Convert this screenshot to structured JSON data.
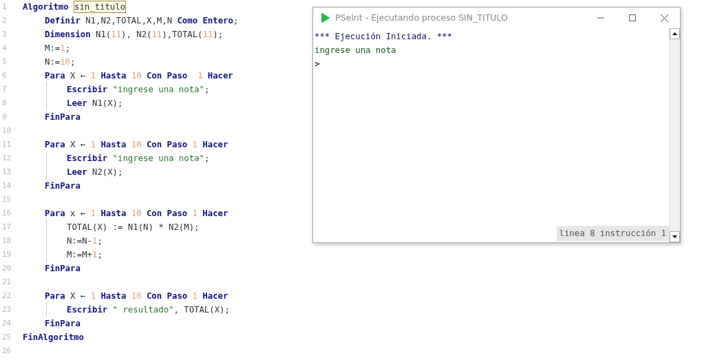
{
  "editor": {
    "lines": [
      {
        "number": "1",
        "tokens": [
          {
            "kind": "keyword",
            "text": "Algoritmo",
            "space_after": true
          },
          {
            "kind": "name",
            "text": "sin_titulo"
          }
        ],
        "children": [
          {
            "number": "2",
            "tokens": [
              {
                "kind": "keyword",
                "text": "Definir",
                "space_after": true
              },
              {
                "kind": "plain",
                "text": "N1,N2,TOTAL,X,M,N",
                "space_after": true
              },
              {
                "kind": "keyword",
                "text": "Como Entero"
              },
              {
                "kind": "plain",
                "text": ";"
              }
            ]
          },
          {
            "number": "3",
            "tokens": [
              {
                "kind": "keyword",
                "text": "Dimension",
                "space_after": true
              },
              {
                "kind": "plain",
                "text": "N1("
              },
              {
                "kind": "number",
                "text": "11"
              },
              {
                "kind": "plain",
                "text": "), N2("
              },
              {
                "kind": "number",
                "text": "11"
              },
              {
                "kind": "plain",
                "text": "),TOTAL("
              },
              {
                "kind": "number",
                "text": "11"
              },
              {
                "kind": "plain",
                "text": ");"
              }
            ]
          },
          {
            "number": "4",
            "tokens": [
              {
                "kind": "plain",
                "text": "M:="
              },
              {
                "kind": "number",
                "text": "1"
              },
              {
                "kind": "plain",
                "text": ";"
              }
            ]
          },
          {
            "number": "5",
            "tokens": [
              {
                "kind": "plain",
                "text": "N:="
              },
              {
                "kind": "number",
                "text": "10"
              },
              {
                "kind": "plain",
                "text": ";"
              }
            ]
          },
          {
            "number": "6",
            "tokens": [
              {
                "kind": "keyword",
                "text": "Para",
                "space_after": true
              },
              {
                "kind": "plain",
                "text": "X ←",
                "space_after": true
              },
              {
                "kind": "number",
                "text": "1",
                "space_after": true
              },
              {
                "kind": "keyword",
                "text": "Hasta",
                "space_after": true
              },
              {
                "kind": "number",
                "text": "10",
                "space_after": true
              },
              {
                "kind": "keyword",
                "text": "Con Paso",
                "space_after": true
              },
              {
                "kind": "number",
                "text": "1",
                "space_before": true,
                "space_after": true
              },
              {
                "kind": "keyword",
                "text": "Hacer"
              }
            ],
            "children": [
              {
                "number": "7",
                "tokens": [
                  {
                    "kind": "keyword",
                    "text": "Escribir",
                    "space_after": true
                  },
                  {
                    "kind": "string",
                    "text": "\"ingrese una nota\""
                  },
                  {
                    "kind": "plain",
                    "text": ";"
                  }
                ]
              },
              {
                "number": "8",
                "tokens": [
                  {
                    "kind": "keyword",
                    "text": "Leer",
                    "space_after": true
                  },
                  {
                    "kind": "plain",
                    "text": "N1(X);"
                  }
                ]
              }
            ]
          },
          {
            "number": "9",
            "tokens": [
              {
                "kind": "keyword",
                "text": "FinPara"
              }
            ]
          },
          {
            "number": "10"
          },
          {
            "number": "11",
            "tokens": [
              {
                "kind": "keyword",
                "text": "Para",
                "space_after": true
              },
              {
                "kind": "plain",
                "text": "X ←",
                "space_after": true
              },
              {
                "kind": "number",
                "text": "1",
                "space_after": true
              },
              {
                "kind": "keyword",
                "text": "Hasta",
                "space_after": true
              },
              {
                "kind": "number",
                "text": "10",
                "space_after": true
              },
              {
                "kind": "keyword",
                "text": "Con Paso",
                "space_after": true
              },
              {
                "kind": "number",
                "text": "1",
                "space_after": true
              },
              {
                "kind": "keyword",
                "text": "Hacer"
              }
            ],
            "children": [
              {
                "number": "12",
                "tokens": [
                  {
                    "kind": "keyword",
                    "text": "Escribir",
                    "space_after": true
                  },
                  {
                    "kind": "string",
                    "text": "\"ingrese una nota\""
                  },
                  {
                    "kind": "plain",
                    "text": ";"
                  }
                ]
              },
              {
                "number": "13",
                "tokens": [
                  {
                    "kind": "keyword",
                    "text": "Leer",
                    "space_after": true
                  },
                  {
                    "kind": "plain",
                    "text": "N2(X);"
                  }
                ]
              }
            ]
          },
          {
            "number": "14",
            "tokens": [
              {
                "kind": "keyword",
                "text": "FinPara"
              }
            ]
          },
          {
            "number": "15"
          },
          {
            "number": "16",
            "tokens": [
              {
                "kind": "keyword",
                "text": "Para",
                "space_after": true
              },
              {
                "kind": "plain",
                "text": "x ←",
                "space_after": true
              },
              {
                "kind": "number",
                "text": "1",
                "space_after": true
              },
              {
                "kind": "keyword",
                "text": "Hasta",
                "space_after": true
              },
              {
                "kind": "number",
                "text": "10",
                "space_after": true
              },
              {
                "kind": "keyword",
                "text": "Con Paso",
                "space_after": true
              },
              {
                "kind": "number",
                "text": "1",
                "space_after": true
              },
              {
                "kind": "keyword",
                "text": "Hacer"
              }
            ],
            "children": [
              {
                "number": "17",
                "tokens": [
                  {
                    "kind": "plain",
                    "text": "TOTAL(X) := N1(N) * N2(M);"
                  }
                ]
              },
              {
                "number": "18",
                "tokens": [
                  {
                    "kind": "plain",
                    "text": "N:=N-"
                  },
                  {
                    "kind": "number",
                    "text": "1"
                  },
                  {
                    "kind": "plain",
                    "text": ";"
                  }
                ]
              },
              {
                "number": "19",
                "tokens": [
                  {
                    "kind": "plain",
                    "text": "M:=M+"
                  },
                  {
                    "kind": "number",
                    "text": "1"
                  },
                  {
                    "kind": "plain",
                    "text": ";"
                  }
                ]
              }
            ]
          },
          {
            "number": "20",
            "tokens": [
              {
                "kind": "keyword",
                "text": "FinPara"
              }
            ]
          },
          {
            "number": "21"
          },
          {
            "number": "22",
            "tokens": [
              {
                "kind": "keyword",
                "text": "Para",
                "space_after": true
              },
              {
                "kind": "plain",
                "text": "X ←",
                "space_after": true
              },
              {
                "kind": "number",
                "text": "1",
                "space_after": true
              },
              {
                "kind": "keyword",
                "text": "Hasta",
                "space_after": true
              },
              {
                "kind": "number",
                "text": "10",
                "space_after": true
              },
              {
                "kind": "keyword",
                "text": "Con Paso",
                "space_after": true
              },
              {
                "kind": "number",
                "text": "1",
                "space_after": true
              },
              {
                "kind": "keyword",
                "text": "Hacer"
              }
            ],
            "children": [
              {
                "number": "23",
                "tokens": [
                  {
                    "kind": "keyword",
                    "text": "Escribir",
                    "space_after": true
                  },
                  {
                    "kind": "string",
                    "text": "\" resultado\""
                  },
                  {
                    "kind": "plain",
                    "text": ", TOTAL(X);"
                  }
                ]
              }
            ]
          },
          {
            "number": "24",
            "tokens": [
              {
                "kind": "keyword",
                "text": "FinPara"
              }
            ]
          }
        ]
      },
      {
        "number": "25",
        "tokens": [
          {
            "kind": "keyword",
            "text": "FinAlgoritmo"
          }
        ]
      },
      {
        "number": "26"
      }
    ]
  },
  "console_window": {
    "title": "PSeInt - Ejecutando proceso SIN_TITULO",
    "lines": [
      {
        "kind": "system",
        "text": "*** Ejecución Iniciada. ***"
      },
      {
        "kind": "output",
        "text": "ingrese una nota"
      },
      {
        "kind": "prompt",
        "text": ">"
      }
    ],
    "status": "linea 8 instrucción 1"
  }
}
